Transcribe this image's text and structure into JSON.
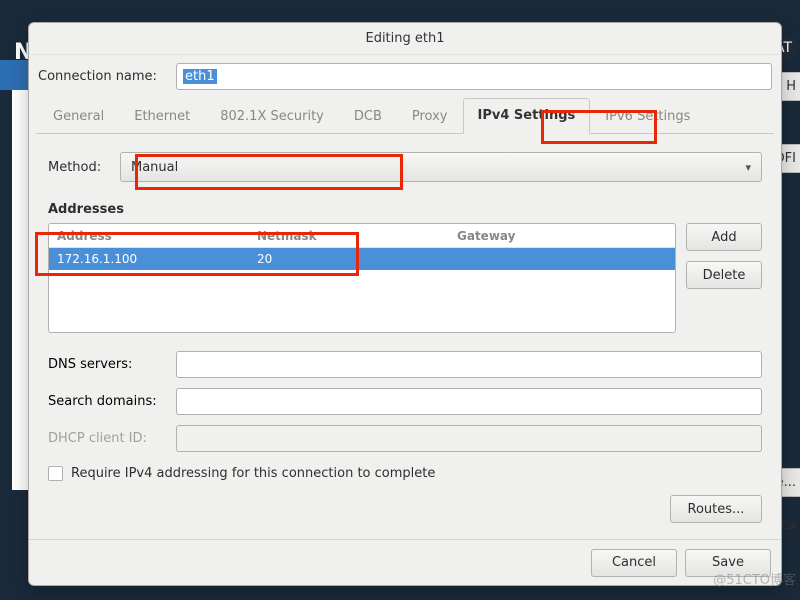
{
  "bg": {
    "title_char": "N",
    "right_top": "LLAT",
    "h_btn": "H",
    "off_btn": "OFI",
    "ure_btn": "ıre...",
    "loca": "loca"
  },
  "dialog": {
    "title": "Editing eth1",
    "conn_name_label": "Connection name:",
    "conn_name_value": "eth1",
    "tabs": {
      "general": "General",
      "ethernet": "Ethernet",
      "sec": "802.1X Security",
      "dcb": "DCB",
      "proxy": "Proxy",
      "ipv4": "IPv4 Settings",
      "ipv6": "IPv6 Settings"
    },
    "method_label": "Method:",
    "method_value": "Manual",
    "addresses_title": "Addresses",
    "addr_headers": {
      "addr": "Address",
      "mask": "Netmask",
      "gw": "Gateway"
    },
    "addr_rows": [
      {
        "addr": "172.16.1.100",
        "mask": "20",
        "gw": ""
      }
    ],
    "btn_add": "Add",
    "btn_delete": "Delete",
    "dns_label": "DNS servers:",
    "search_label": "Search domains:",
    "dhcp_label": "DHCP client ID:",
    "require_check": "Require IPv4 addressing for this connection to complete",
    "routes_btn": "Routes...",
    "cancel": "Cancel",
    "save": "Save"
  },
  "watermark": "@51CTO博客"
}
